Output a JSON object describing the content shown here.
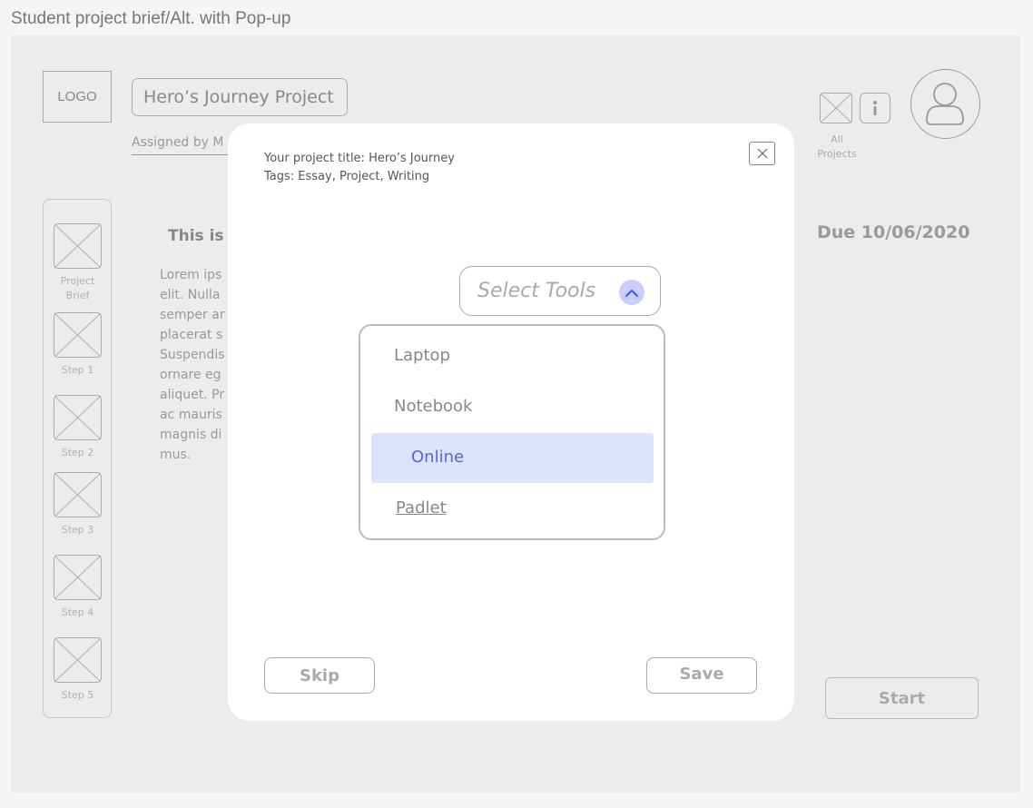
{
  "frame_title": "Student project brief/Alt. with Pop-up",
  "header": {
    "logo": "LOGO",
    "project_title": "Hero’s Journey Project",
    "assigned": "Assigned by M",
    "all_projects": "All Projects",
    "due": "Due 10/06/2020"
  },
  "sidebar": {
    "items": [
      {
        "label": "Project Brief"
      },
      {
        "label": "Step 1"
      },
      {
        "label": "Step 2"
      },
      {
        "label": "Step 3"
      },
      {
        "label": "Step 4"
      },
      {
        "label": "Step 5"
      }
    ]
  },
  "brief": {
    "heading": "This is t",
    "lines": [
      "Lorem ips",
      "elit. Nulla",
      "semper ar",
      "placerat s",
      "Suspendis",
      "ornare eg",
      "aliquet. Pr",
      "ac mauris",
      "magnis di",
      "mus."
    ]
  },
  "start_label": "Start",
  "modal": {
    "title_line": "Your project title: Hero’s Journey",
    "tags_line": "Tags: Essay, Project, Writing",
    "select_placeholder": "Select Tools",
    "options": [
      "Laptop",
      "Notebook",
      "Online",
      "Padlet"
    ],
    "selected_option": "Online",
    "skip_label": "Skip",
    "save_label": "Save"
  },
  "colors": {
    "selected_bg": "#dde2fd",
    "selected_text": "#5568d6",
    "chevron_bg": "#c9cdfb"
  },
  "icons": [
    "close-icon",
    "chevron-up-icon",
    "info-icon",
    "placeholder-image-icon",
    "user-avatar-icon"
  ]
}
